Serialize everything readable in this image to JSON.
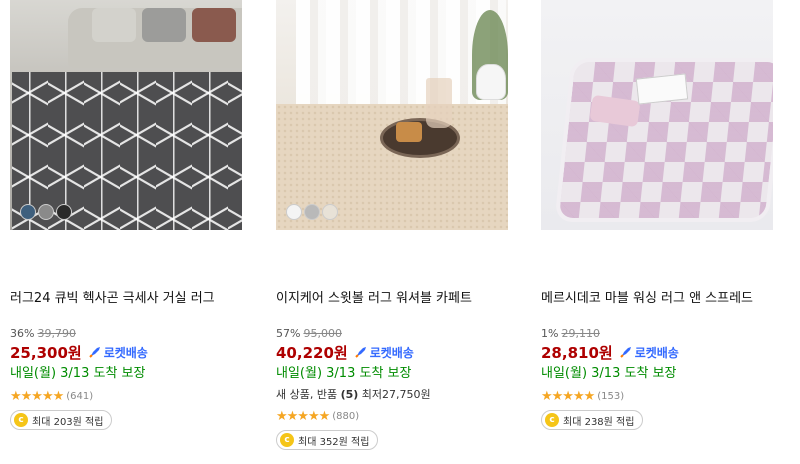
{
  "products": [
    {
      "title": "러그24 큐빅 헥사곤 극세사 거실 러그",
      "discount": "36%",
      "original_price": "39,790",
      "price": "25,300원",
      "rocket_label": "로켓배송",
      "delivery": "내일(월) 3/13 도착 보장",
      "rating": 4.5,
      "review_count": "(641)",
      "reward": "최대 203원 적립",
      "swatch_colors": [
        "#3e5f7d",
        "#8a8a8a",
        "#2a2a2a"
      ]
    },
    {
      "title": "이지케어 스윗볼 러그 워셔블 카페트",
      "discount": "57%",
      "original_price": "95,000",
      "price": "40,220원",
      "rocket_label": "로켓배송",
      "delivery": "내일(월) 3/13 도착 보장",
      "extra_prefix": "새 상품, 반품 ",
      "extra_count": "(5)",
      "extra_suffix": " 최저27,750원",
      "rating": 4.5,
      "review_count": "(880)",
      "reward": "최대 352원 적립",
      "swatch_colors": [
        "#f4f4f4",
        "#b9b9b9",
        "#e8e2d7"
      ]
    },
    {
      "title": "메르시데코 마블 워싱 러그 앤 스프레드",
      "discount": "1%",
      "original_price": "29,110",
      "price": "28,810원",
      "rocket_label": "로켓배송",
      "delivery": "내일(월) 3/13 도착 보장",
      "rating": 4.5,
      "review_count": "(153)",
      "reward": "최대 238원 적립"
    }
  ],
  "colors": {
    "price": "#ae0000",
    "rocket": "#346aff",
    "delivery": "#008c00",
    "star": "#f5a623",
    "coin": "#f5c518"
  },
  "icons": {
    "rocket": "rocket-icon",
    "coin": "coin-icon",
    "star": "star-icon"
  },
  "star_glyphs": "★★★★★",
  "coin_glyph": "c"
}
